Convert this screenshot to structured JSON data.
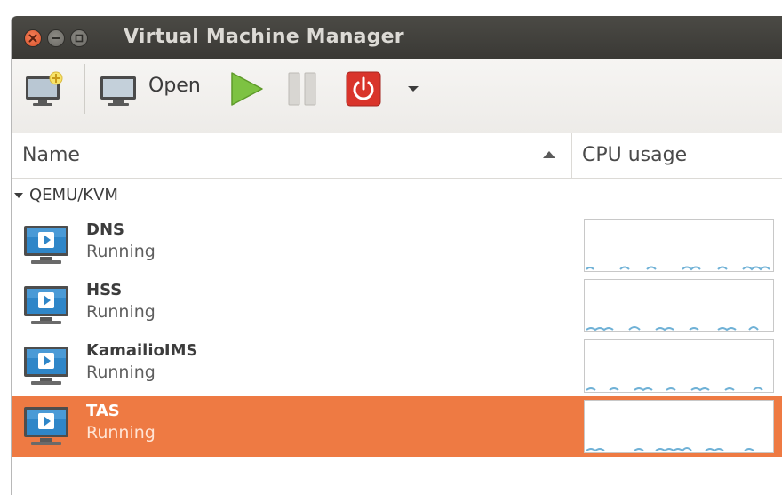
{
  "window": {
    "title": "Virtual Machine Manager"
  },
  "toolbar": {
    "new_vm_icon": "new-vm-icon",
    "open_label": "Open",
    "run_icon": "play-icon",
    "pause_icon": "pause-icon",
    "shutdown_icon": "power-icon",
    "menu_icon": "chevron-down-icon"
  },
  "columns": {
    "name": "Name",
    "cpu": "CPU usage"
  },
  "group": {
    "label": "QEMU/KVM"
  },
  "vms": [
    {
      "name": "DNS",
      "status": "Running",
      "selected": false
    },
    {
      "name": "HSS",
      "status": "Running",
      "selected": false
    },
    {
      "name": "KamailioIMS",
      "status": "Running",
      "selected": false
    },
    {
      "name": "TAS",
      "status": "Running",
      "selected": true
    }
  ],
  "colors": {
    "selection": "#ee7a43",
    "play": "#7dc242",
    "power": "#d9342b",
    "graph_line": "#6fb1d6"
  }
}
